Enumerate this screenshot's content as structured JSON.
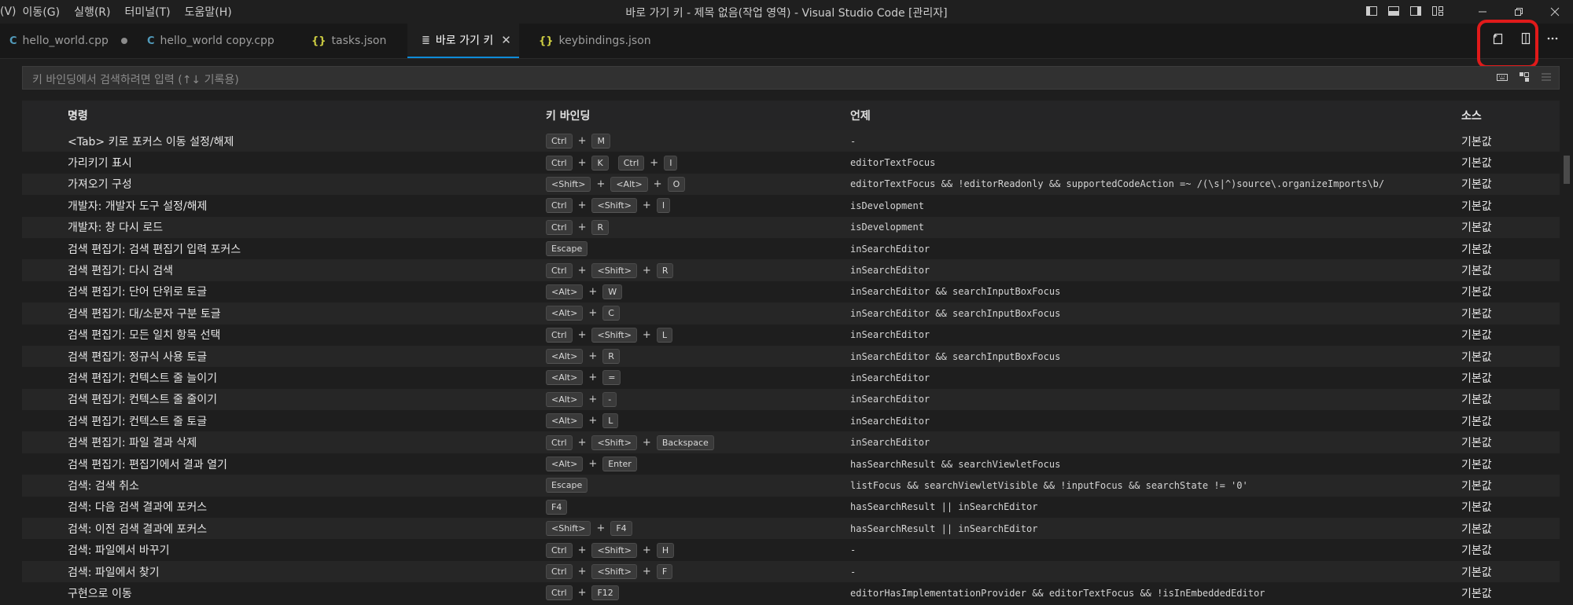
{
  "menu": [
    "(V)",
    "이동(G)",
    "실행(R)",
    "터미널(T)",
    "도움말(H)"
  ],
  "window_title": "바로 가기 키 - 제목 없음(작업 영역) - Visual Studio Code [관리자]",
  "tabs": [
    {
      "label": "hello_world.cpp",
      "icon": "cpp-file-icon"
    },
    {
      "label": "hello_world copy.cpp",
      "icon": "cpp-file-icon"
    },
    {
      "label": "tasks.json",
      "icon": "json-file-icon"
    },
    {
      "label": "바로 가기 키",
      "icon": "keyboard-shortcuts-icon"
    },
    {
      "label": "keybindings.json",
      "icon": "json-file-icon"
    }
  ],
  "search": {
    "placeholder": "키 바인딩에서 검색하려면 입력 (↑↓ 기록용)"
  },
  "columns": {
    "command": "명령",
    "keybinding": "키 바인딩",
    "when": "언제",
    "source": "소스"
  },
  "rows": [
    {
      "command": "<Tab> 키로 포커스 이동 설정/해제",
      "keys": [
        [
          "Ctrl",
          "M"
        ]
      ],
      "when": "-",
      "source": "기본값"
    },
    {
      "command": "가리키기 표시",
      "keys": [
        [
          "Ctrl",
          "K"
        ],
        [
          "Ctrl",
          "I"
        ]
      ],
      "when": "editorTextFocus",
      "source": "기본값"
    },
    {
      "command": "가져오기 구성",
      "keys": [
        [
          "<Shift>",
          "<Alt>",
          "O"
        ]
      ],
      "when": "editorTextFocus && !editorReadonly && supportedCodeAction =~ /(\\s|^)source\\.organizeImports\\b/",
      "source": "기본값"
    },
    {
      "command": "개발자: 개발자 도구 설정/해제",
      "keys": [
        [
          "Ctrl",
          "<Shift>",
          "I"
        ]
      ],
      "when": "isDevelopment",
      "source": "기본값"
    },
    {
      "command": "개발자: 창 다시 로드",
      "keys": [
        [
          "Ctrl",
          "R"
        ]
      ],
      "when": "isDevelopment",
      "source": "기본값"
    },
    {
      "command": "검색 편집기: 검색 편집기 입력 포커스",
      "keys": [
        [
          "Escape"
        ]
      ],
      "when": "inSearchEditor",
      "source": "기본값"
    },
    {
      "command": "검색 편집기: 다시 검색",
      "keys": [
        [
          "Ctrl",
          "<Shift>",
          "R"
        ]
      ],
      "when": "inSearchEditor",
      "source": "기본값"
    },
    {
      "command": "검색 편집기: 단어 단위로 토글",
      "keys": [
        [
          "<Alt>",
          "W"
        ]
      ],
      "when": "inSearchEditor && searchInputBoxFocus",
      "source": "기본값"
    },
    {
      "command": "검색 편집기: 대/소문자 구분 토글",
      "keys": [
        [
          "<Alt>",
          "C"
        ]
      ],
      "when": "inSearchEditor && searchInputBoxFocus",
      "source": "기본값"
    },
    {
      "command": "검색 편집기: 모든 일치 항목 선택",
      "keys": [
        [
          "Ctrl",
          "<Shift>",
          "L"
        ]
      ],
      "when": "inSearchEditor",
      "source": "기본값"
    },
    {
      "command": "검색 편집기: 정규식 사용 토글",
      "keys": [
        [
          "<Alt>",
          "R"
        ]
      ],
      "when": "inSearchEditor && searchInputBoxFocus",
      "source": "기본값"
    },
    {
      "command": "검색 편집기: 컨텍스트 줄 늘이기",
      "keys": [
        [
          "<Alt>",
          "="
        ]
      ],
      "when": "inSearchEditor",
      "source": "기본값"
    },
    {
      "command": "검색 편집기: 컨텍스트 줄 줄이기",
      "keys": [
        [
          "<Alt>",
          "-"
        ]
      ],
      "when": "inSearchEditor",
      "source": "기본값"
    },
    {
      "command": "검색 편집기: 컨텍스트 줄 토글",
      "keys": [
        [
          "<Alt>",
          "L"
        ]
      ],
      "when": "inSearchEditor",
      "source": "기본값"
    },
    {
      "command": "검색 편집기: 파일 결과 삭제",
      "keys": [
        [
          "Ctrl",
          "<Shift>",
          "Backspace"
        ]
      ],
      "when": "inSearchEditor",
      "source": "기본값"
    },
    {
      "command": "검색 편집기: 편집기에서 결과 열기",
      "keys": [
        [
          "<Alt>",
          "Enter"
        ]
      ],
      "when": "hasSearchResult && searchViewletFocus",
      "source": "기본값"
    },
    {
      "command": "검색: 검색 취소",
      "keys": [
        [
          "Escape"
        ]
      ],
      "when": "listFocus && searchViewletVisible && !inputFocus && searchState != '0'",
      "source": "기본값"
    },
    {
      "command": "검색: 다음 검색 결과에 포커스",
      "keys": [
        [
          "F4"
        ]
      ],
      "when": "hasSearchResult || inSearchEditor",
      "source": "기본값"
    },
    {
      "command": "검색: 이전 검색 결과에 포커스",
      "keys": [
        [
          "<Shift>",
          "F4"
        ]
      ],
      "when": "hasSearchResult || inSearchEditor",
      "source": "기본값"
    },
    {
      "command": "검색: 파일에서 바꾸기",
      "keys": [
        [
          "Ctrl",
          "<Shift>",
          "H"
        ]
      ],
      "when": "-",
      "source": "기본값"
    },
    {
      "command": "검색: 파일에서 찾기",
      "keys": [
        [
          "Ctrl",
          "<Shift>",
          "F"
        ]
      ],
      "when": "-",
      "source": "기본값"
    },
    {
      "command": "구현으로 이동",
      "keys": [
        [
          "Ctrl",
          "F12"
        ]
      ],
      "when": "editorHasImplementationProvider && editorTextFocus && !isInEmbeddedEditor",
      "source": "기본값"
    }
  ]
}
